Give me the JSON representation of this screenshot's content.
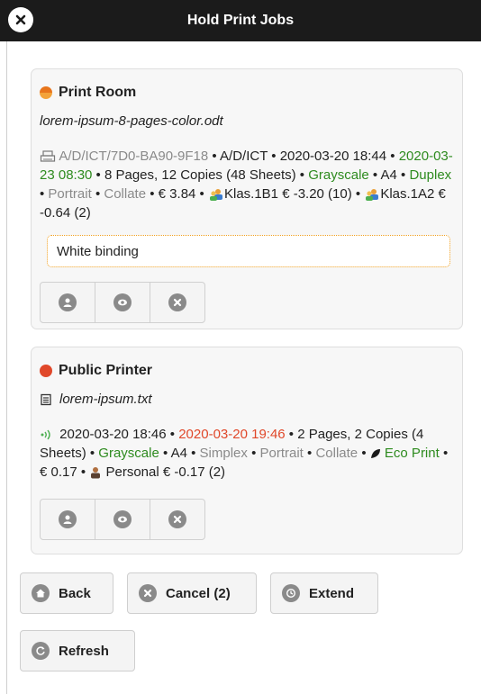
{
  "header": {
    "title": "Hold Print Jobs"
  },
  "jobs": [
    {
      "printer": "Print Room",
      "document": "lorem-ipsum-8-pages-color.odt",
      "path_id": "A/D/ICT/7D0-BA90-9F18",
      "path": "A/D/ICT",
      "submitted": "2020-03-20 18:44",
      "expires": "2020-03-23 08:30",
      "pages": "8 Pages, 12 Copies (48 Sheets)",
      "color_mode": "Grayscale",
      "paper": "A4",
      "sides": "Duplex",
      "orientation": "Portrait",
      "collate": "Collate",
      "cost": "€ 3.84",
      "account1": "Klas.1B1 € -3.20 (10)",
      "account2": "Klas.1A2 € -0.64 (2)",
      "comment": "White binding",
      "status_color": "#e8751c"
    },
    {
      "printer": "Public Printer",
      "document": "lorem-ipsum.txt",
      "submitted": "2020-03-20 18:46",
      "expires": "2020-03-20 19:46",
      "pages_a": "2 Pages, 2",
      "pages_b": "Copies (4 Sheets)",
      "color_mode": "Grayscale",
      "paper": "A4",
      "sides": "Simplex",
      "orientation": "Portrait",
      "collate": "Collate",
      "eco": "Eco Print",
      "cost": "€ 0.17",
      "account": "Personal € -0.17 (2)",
      "status_color": "#e0482a"
    }
  ],
  "actions": {
    "back": "Back",
    "cancel": "Cancel (2)",
    "extend": "Extend",
    "refresh": "Refresh"
  },
  "icons": {
    "close": "close-icon",
    "printer_small": "printer-icon",
    "document": "document-icon",
    "wireless": "wireless-icon",
    "group": "group-icon",
    "eco": "leaf-icon",
    "personal": "person-icon",
    "user": "user-icon",
    "preview": "eye-icon",
    "cancel": "cancel-icon",
    "home": "home-icon",
    "clock": "clock-icon",
    "refresh": "refresh-icon"
  }
}
